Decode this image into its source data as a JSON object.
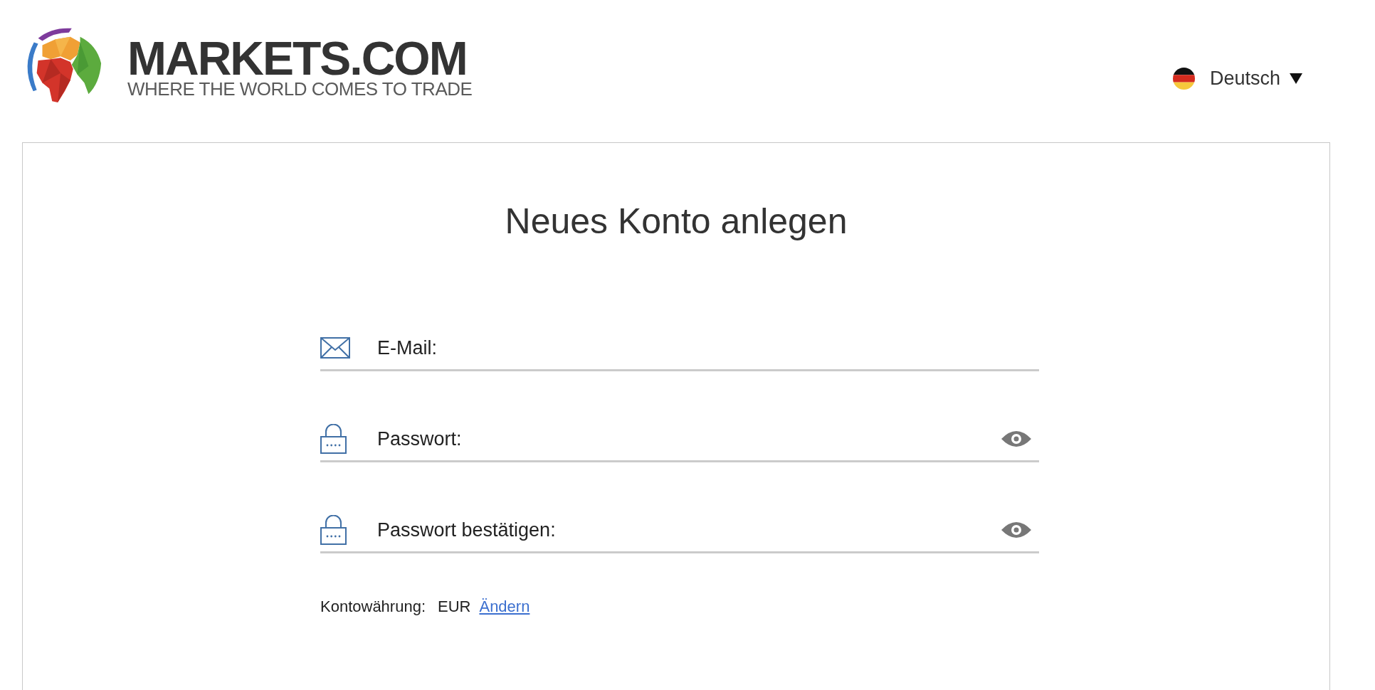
{
  "header": {
    "logo": {
      "name": "MARKETS.COM",
      "tagline": "WHERE THE WORLD COMES TO TRADE"
    },
    "language": {
      "label": "Deutsch"
    }
  },
  "form": {
    "title": "Neues Konto anlegen",
    "fields": [
      {
        "kind": "email",
        "label": "E-Mail:"
      },
      {
        "kind": "password",
        "label": "Passwort:"
      },
      {
        "kind": "password",
        "label": "Passwort bestätigen:"
      }
    ],
    "currency": {
      "label": "Kontowährung:",
      "value": "EUR",
      "link": "Ändern"
    }
  }
}
